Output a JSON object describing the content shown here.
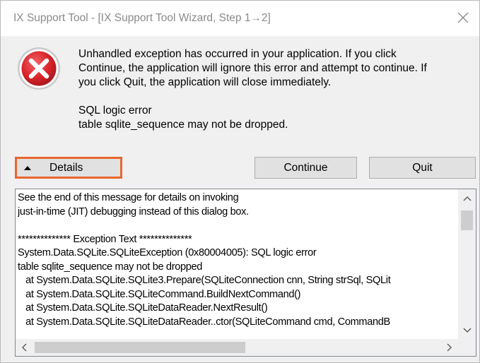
{
  "window": {
    "title": "IX Support Tool - [IX Support Tool Wizard, Step 1→2]",
    "close_icon": "close-icon"
  },
  "error_icon": "error-icon",
  "colors": {
    "error_red": "#d8242a",
    "highlight_border": "#e8672f",
    "button_face": "#e1e1e1"
  },
  "message": {
    "lines": [
      "Unhandled exception has occurred in your application. If you click",
      "Continue, the application will ignore this error and attempt to continue. If",
      "you click Quit, the application will close immediately."
    ],
    "error_lines": [
      "SQL logic error",
      "table sqlite_sequence may not be dropped."
    ]
  },
  "buttons": {
    "details": "Details",
    "continue": "Continue",
    "quit": "Quit"
  },
  "details": {
    "lines": [
      "See the end of this message for details on invoking",
      "just-in-time (JIT) debugging instead of this dialog box.",
      "",
      "************** Exception Text **************",
      "System.Data.SQLite.SQLiteException (0x80004005): SQL logic error",
      "table sqlite_sequence may not be dropped",
      "   at System.Data.SQLite.SQLite3.Prepare(SQLiteConnection cnn, String strSql, SQLit",
      "   at System.Data.SQLite.SQLiteCommand.BuildNextCommand()",
      "   at System.Data.SQLite.SQLiteDataReader.NextResult()",
      "   at System.Data.SQLite.SQLiteDataReader..ctor(SQLiteCommand cmd, CommandB"
    ]
  }
}
